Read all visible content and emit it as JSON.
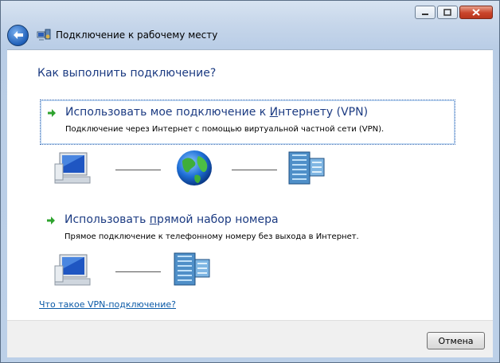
{
  "window": {
    "title": "Подключение к рабочему месту",
    "minimize_icon": "minimize-icon",
    "maximize_icon": "maximize-icon",
    "close_icon": "close-icon"
  },
  "heading": "Как выполнить подключение?",
  "options": [
    {
      "title_pre": "Использовать мое подключение к ",
      "title_accel": "И",
      "title_post": "нтернету (VPN)",
      "description": "Подключение через Интернет с помощью виртуальной частной сети (VPN).",
      "icon": "green-arrow-icon"
    },
    {
      "title_pre": "Использовать ",
      "title_accel": "п",
      "title_post": "рямой набор номера",
      "description": "Прямое подключение к телефонному номеру без выхода в Интернет.",
      "icon": "green-arrow-icon"
    }
  ],
  "help_link": "Что такое VPN-подключение?",
  "footer": {
    "cancel_label": "Отмена"
  },
  "colors": {
    "accent_text": "#1c3b82",
    "link": "#0b5aa7",
    "arrow": "#2ea32e"
  }
}
